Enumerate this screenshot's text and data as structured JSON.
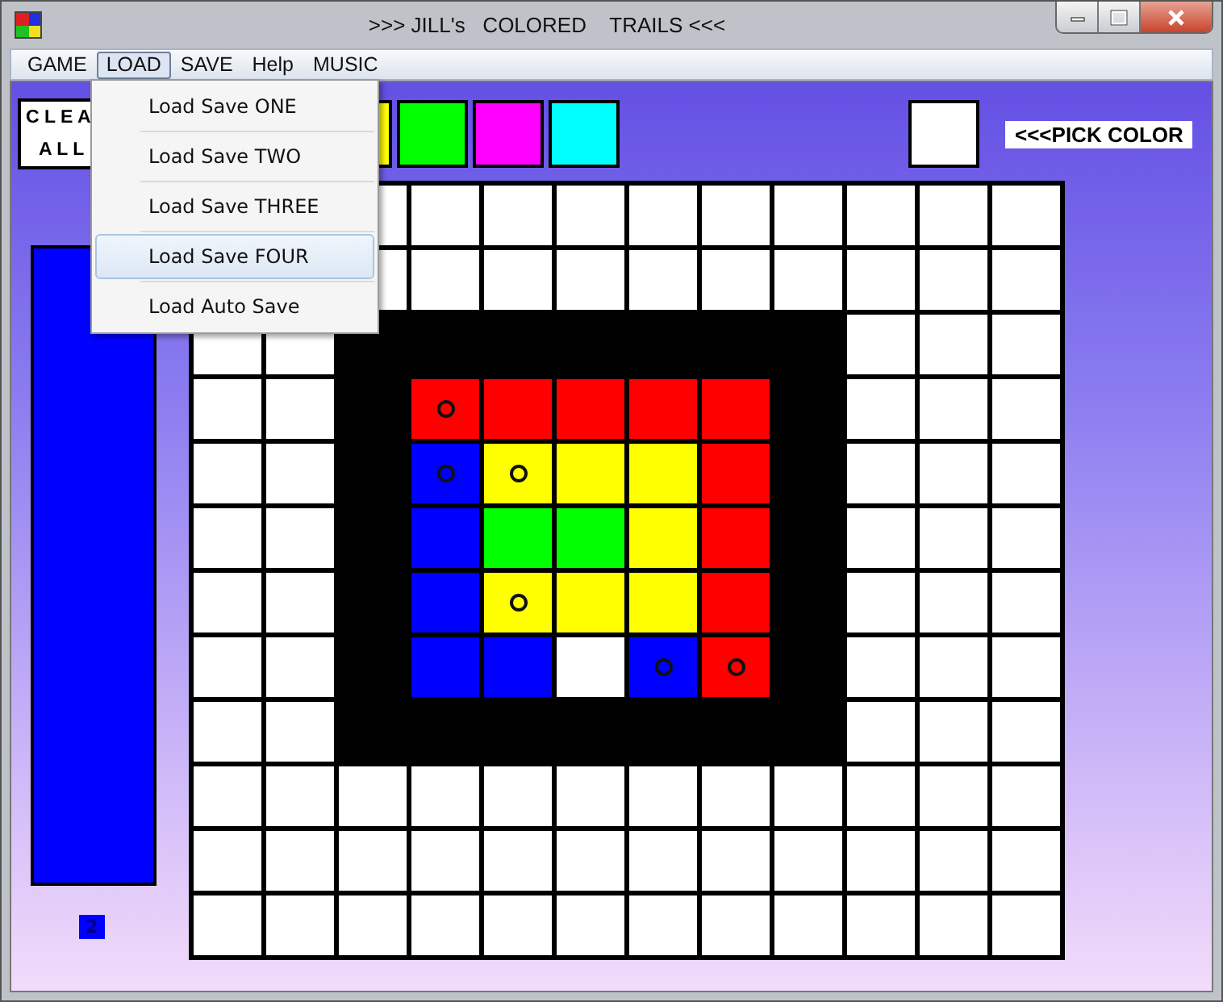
{
  "window": {
    "title": ">>> JILL's   COLORED    TRAILS <<<"
  },
  "menu_bar": [
    {
      "label": "GAME",
      "selected": false
    },
    {
      "label": "LOAD",
      "selected": true
    },
    {
      "label": "SAVE",
      "selected": false
    },
    {
      "label": "Help",
      "selected": false
    },
    {
      "label": "MUSIC",
      "selected": false
    }
  ],
  "load_menu": [
    {
      "label": "Load Save ONE",
      "selected": false
    },
    {
      "label": "Load Save TWO",
      "selected": false
    },
    {
      "label": "Load Save THREE",
      "selected": false
    },
    {
      "label": "Load Save FOUR",
      "selected": true
    },
    {
      "label": "Load Auto Save",
      "selected": false
    }
  ],
  "clear_button": {
    "lines": [
      "C L E A",
      "A L L"
    ]
  },
  "swatches": [
    {
      "color": "#ffff00"
    },
    {
      "color": "#00ff00"
    },
    {
      "color": "#ff00ff"
    },
    {
      "color": "#00ffff"
    }
  ],
  "current_color": {
    "color": "#ffffff"
  },
  "pick_label": "<<<PICK COLOR",
  "player_bar": {
    "color": "#0000ff"
  },
  "counter": {
    "text": "2",
    "color": "#0000ff"
  },
  "board": {
    "rows": [
      [
        {
          "color": "#ffffff",
          "marked": false
        },
        {
          "color": "#ffffff",
          "marked": false
        },
        {
          "color": "#ffffff",
          "marked": false
        },
        {
          "color": "#ffffff",
          "marked": false
        },
        {
          "color": "#ffffff",
          "marked": false
        },
        {
          "color": "#ffffff",
          "marked": false
        },
        {
          "color": "#ffffff",
          "marked": false
        },
        {
          "color": "#ffffff",
          "marked": false
        },
        {
          "color": "#ffffff",
          "marked": false
        },
        {
          "color": "#ffffff",
          "marked": false
        }
      ],
      [
        {
          "color": "#ffffff",
          "marked": false
        },
        {
          "color": "#ffffff",
          "marked": false
        },
        {
          "color": "#ffffff",
          "marked": false
        },
        {
          "color": "#ffffff",
          "marked": false
        },
        {
          "color": "#ffffff",
          "marked": false
        },
        {
          "color": "#ffffff",
          "marked": false
        },
        {
          "color": "#ffffff",
          "marked": false
        },
        {
          "color": "#ffffff",
          "marked": false
        },
        {
          "color": "#ffffff",
          "marked": false
        },
        {
          "color": "#ffffff",
          "marked": false
        }
      ],
      [
        {
          "color": "#ffffff",
          "marked": false
        },
        {
          "color": "#ffffff",
          "marked": false
        },
        {
          "color": "#000000",
          "marked": false
        },
        {
          "color": "#000000",
          "marked": false
        },
        {
          "color": "#000000",
          "marked": false
        },
        {
          "color": "#000000",
          "marked": false
        },
        {
          "color": "#000000",
          "marked": false
        },
        {
          "color": "#000000",
          "marked": false
        },
        {
          "color": "#000000",
          "marked": false
        },
        {
          "color": "#ffffff",
          "marked": false
        },
        {
          "color": "#ffffff",
          "marked": false
        },
        {
          "color": "#ffffff",
          "marked": false
        }
      ],
      [
        {
          "color": "#ffffff",
          "marked": false
        },
        {
          "color": "#ffffff",
          "marked": false
        },
        {
          "color": "#000000",
          "marked": false
        },
        {
          "color": "#ff0000",
          "marked": true
        },
        {
          "color": "#ff0000",
          "marked": false
        },
        {
          "color": "#ff0000",
          "marked": false
        },
        {
          "color": "#ff0000",
          "marked": false
        },
        {
          "color": "#ff0000",
          "marked": false
        },
        {
          "color": "#000000",
          "marked": false
        },
        {
          "color": "#ffffff",
          "marked": false
        },
        {
          "color": "#ffffff",
          "marked": false
        },
        {
          "color": "#ffffff",
          "marked": false
        }
      ],
      [
        {
          "color": "#ffffff",
          "marked": false
        },
        {
          "color": "#ffffff",
          "marked": false
        },
        {
          "color": "#000000",
          "marked": false
        },
        {
          "color": "#0000ff",
          "marked": true
        },
        {
          "color": "#ffff00",
          "marked": true
        },
        {
          "color": "#ffff00",
          "marked": false
        },
        {
          "color": "#ffff00",
          "marked": false
        },
        {
          "color": "#ff0000",
          "marked": false
        },
        {
          "color": "#000000",
          "marked": false
        },
        {
          "color": "#ffffff",
          "marked": false
        },
        {
          "color": "#ffffff",
          "marked": false
        },
        {
          "color": "#ffffff",
          "marked": false
        }
      ],
      [
        {
          "color": "#ffffff",
          "marked": false
        },
        {
          "color": "#ffffff",
          "marked": false
        },
        {
          "color": "#000000",
          "marked": false
        },
        {
          "color": "#0000ff",
          "marked": false
        },
        {
          "color": "#00ff00",
          "marked": false
        },
        {
          "color": "#00ff00",
          "marked": false
        },
        {
          "color": "#ffff00",
          "marked": false
        },
        {
          "color": "#ff0000",
          "marked": false
        },
        {
          "color": "#000000",
          "marked": false
        },
        {
          "color": "#ffffff",
          "marked": false
        },
        {
          "color": "#ffffff",
          "marked": false
        },
        {
          "color": "#ffffff",
          "marked": false
        }
      ],
      [
        {
          "color": "#ffffff",
          "marked": false
        },
        {
          "color": "#ffffff",
          "marked": false
        },
        {
          "color": "#000000",
          "marked": false
        },
        {
          "color": "#0000ff",
          "marked": false
        },
        {
          "color": "#ffff00",
          "marked": true
        },
        {
          "color": "#ffff00",
          "marked": false
        },
        {
          "color": "#ffff00",
          "marked": false
        },
        {
          "color": "#ff0000",
          "marked": false
        },
        {
          "color": "#000000",
          "marked": false
        },
        {
          "color": "#ffffff",
          "marked": false
        },
        {
          "color": "#ffffff",
          "marked": false
        },
        {
          "color": "#ffffff",
          "marked": false
        }
      ],
      [
        {
          "color": "#ffffff",
          "marked": false
        },
        {
          "color": "#ffffff",
          "marked": false
        },
        {
          "color": "#000000",
          "marked": false
        },
        {
          "color": "#0000ff",
          "marked": false
        },
        {
          "color": "#0000ff",
          "marked": false
        },
        {
          "color": "#ffffff",
          "marked": false
        },
        {
          "color": "#0000ff",
          "marked": true
        },
        {
          "color": "#ff0000",
          "marked": true
        },
        {
          "color": "#000000",
          "marked": false
        },
        {
          "color": "#ffffff",
          "marked": false
        },
        {
          "color": "#ffffff",
          "marked": false
        },
        {
          "color": "#ffffff",
          "marked": false
        }
      ],
      [
        {
          "color": "#ffffff",
          "marked": false
        },
        {
          "color": "#ffffff",
          "marked": false
        },
        {
          "color": "#000000",
          "marked": false
        },
        {
          "color": "#000000",
          "marked": false
        },
        {
          "color": "#000000",
          "marked": false
        },
        {
          "color": "#000000",
          "marked": false
        },
        {
          "color": "#000000",
          "marked": false
        },
        {
          "color": "#000000",
          "marked": false
        },
        {
          "color": "#000000",
          "marked": false
        },
        {
          "color": "#ffffff",
          "marked": false
        },
        {
          "color": "#ffffff",
          "marked": false
        },
        {
          "color": "#ffffff",
          "marked": false
        }
      ],
      [
        {
          "color": "#ffffff",
          "marked": false
        },
        {
          "color": "#ffffff",
          "marked": false
        },
        {
          "color": "#ffffff",
          "marked": false
        },
        {
          "color": "#ffffff",
          "marked": false
        },
        {
          "color": "#ffffff",
          "marked": false
        },
        {
          "color": "#ffffff",
          "marked": false
        },
        {
          "color": "#ffffff",
          "marked": false
        },
        {
          "color": "#ffffff",
          "marked": false
        },
        {
          "color": "#ffffff",
          "marked": false
        },
        {
          "color": "#ffffff",
          "marked": false
        },
        {
          "color": "#ffffff",
          "marked": false
        },
        {
          "color": "#ffffff",
          "marked": false
        }
      ],
      [
        {
          "color": "#ffffff",
          "marked": false
        },
        {
          "color": "#ffffff",
          "marked": false
        },
        {
          "color": "#ffffff",
          "marked": false
        },
        {
          "color": "#ffffff",
          "marked": false
        },
        {
          "color": "#ffffff",
          "marked": false
        },
        {
          "color": "#ffffff",
          "marked": false
        },
        {
          "color": "#ffffff",
          "marked": false
        },
        {
          "color": "#ffffff",
          "marked": false
        },
        {
          "color": "#ffffff",
          "marked": false
        },
        {
          "color": "#ffffff",
          "marked": false
        },
        {
          "color": "#ffffff",
          "marked": false
        },
        {
          "color": "#ffffff",
          "marked": false
        }
      ],
      [
        {
          "color": "#ffffff",
          "marked": false
        },
        {
          "color": "#ffffff",
          "marked": false
        },
        {
          "color": "#ffffff",
          "marked": false
        },
        {
          "color": "#ffffff",
          "marked": false
        },
        {
          "color": "#ffffff",
          "marked": false
        },
        {
          "color": "#ffffff",
          "marked": false
        },
        {
          "color": "#ffffff",
          "marked": false
        },
        {
          "color": "#ffffff",
          "marked": false
        },
        {
          "color": "#ffffff",
          "marked": false
        },
        {
          "color": "#ffffff",
          "marked": false
        },
        {
          "color": "#ffffff",
          "marked": false
        },
        {
          "color": "#ffffff",
          "marked": false
        }
      ]
    ]
  }
}
